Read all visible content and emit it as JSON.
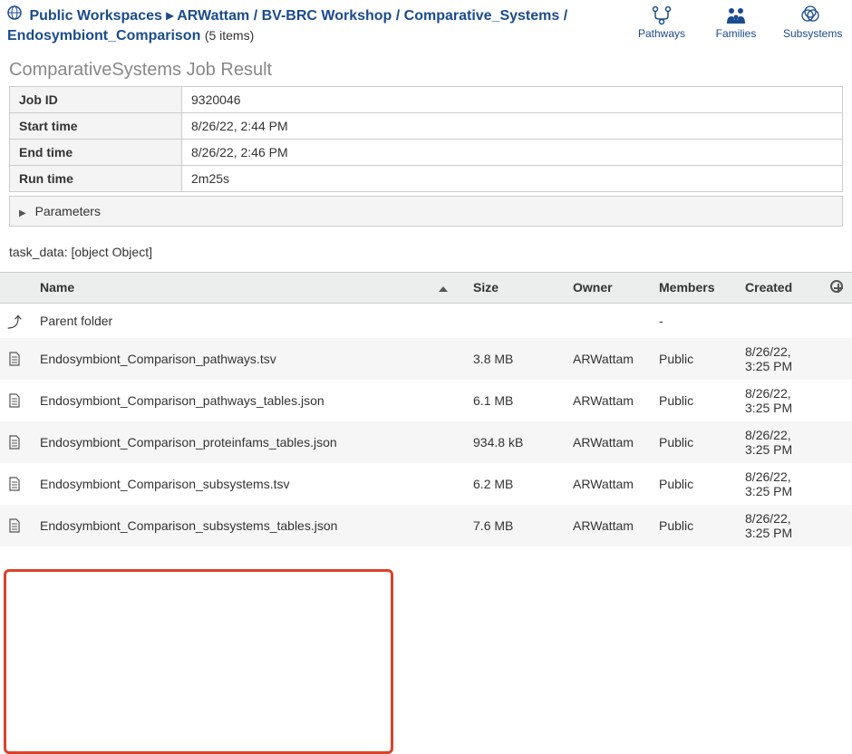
{
  "breadcrumb": {
    "root": "Public Workspaces",
    "path_bold": "ARWattam",
    "path_rest": " / BV-BRC Workshop / Comparative_Systems / Endosymbiont_Comparison",
    "items_count": "(5 items)"
  },
  "top_links": {
    "pathways": "Pathways",
    "families": "Families",
    "subsystems": "Subsystems"
  },
  "job_result_heading": "ComparativeSystems Job Result",
  "meta": {
    "job_id_label": "Job ID",
    "job_id": "9320046",
    "start_label": "Start time",
    "start": "8/26/22, 2:44 PM",
    "end_label": "End time",
    "end": "8/26/22, 2:46 PM",
    "run_label": "Run time",
    "run": "2m25s"
  },
  "parameters_label": "Parameters",
  "task_data": "task_data: [object Object]",
  "columns": {
    "name": "Name",
    "size": "Size",
    "owner": "Owner",
    "members": "Members",
    "created": "Created"
  },
  "rows": {
    "parent": {
      "name": "Parent folder",
      "members": "-"
    },
    "r1": {
      "name": "Endosymbiont_Comparison_pathways.tsv",
      "size": "3.8 MB",
      "owner": "ARWattam",
      "members": "Public",
      "created": "8/26/22, 3:25 PM"
    },
    "r2": {
      "name": "Endosymbiont_Comparison_pathways_tables.json",
      "size": "6.1 MB",
      "owner": "ARWattam",
      "members": "Public",
      "created": "8/26/22, 3:25 PM"
    },
    "r3": {
      "name": "Endosymbiont_Comparison_proteinfams_tables.json",
      "size": "934.8 kB",
      "owner": "ARWattam",
      "members": "Public",
      "created": "8/26/22, 3:25 PM"
    },
    "r4": {
      "name": "Endosymbiont_Comparison_subsystems.tsv",
      "size": "6.2 MB",
      "owner": "ARWattam",
      "members": "Public",
      "created": "8/26/22, 3:25 PM"
    },
    "r5": {
      "name": "Endosymbiont_Comparison_subsystems_tables.json",
      "size": "7.6 MB",
      "owner": "ARWattam",
      "members": "Public",
      "created": "8/26/22, 3:25 PM"
    }
  }
}
